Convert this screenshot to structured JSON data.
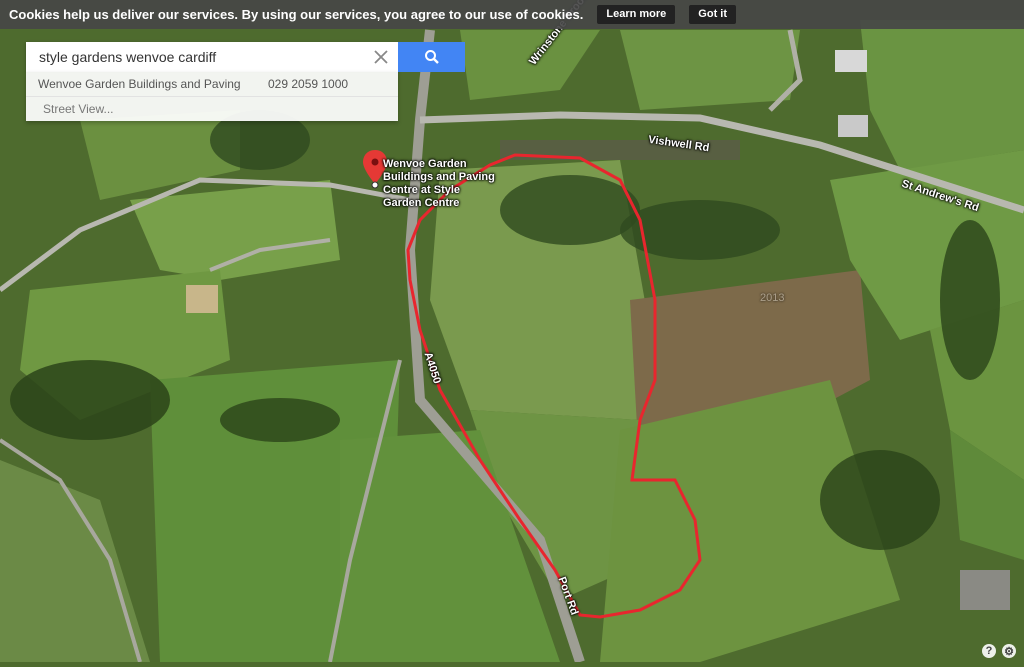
{
  "cookie_bar": {
    "message": "Cookies help us deliver our services. By using our services, you agree to our use of cookies.",
    "learn_more": "Learn more",
    "got_it": "Got it"
  },
  "search": {
    "query": "style gardens wenvoe cardiff",
    "suggestions": [
      {
        "name": "Wenvoe Garden Buildings and Paving",
        "phone": "029 2059 1000"
      },
      {
        "name": "Street View..."
      }
    ]
  },
  "map": {
    "place_name": "Wenvoe Garden Buildings and Paving Centre at Style Garden Centre",
    "road_labels": [
      "Wrinstone Brook",
      "Vishwell Rd",
      "St Andrew's Rd",
      "A4050",
      "Port Rd",
      "2013"
    ],
    "colors": {
      "route": "#e8262e",
      "marker": "#e53935",
      "field": "#5f8a3a",
      "road": "#b8b8b0"
    }
  },
  "controls": {
    "help": "?",
    "settings": "⚙"
  }
}
